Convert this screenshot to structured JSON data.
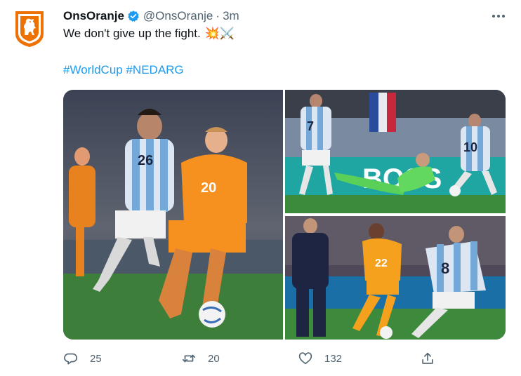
{
  "tweet": {
    "display_name": "OnsOranje",
    "handle": "@OnsOranje",
    "separator": "·",
    "time": "3m",
    "text": "We don't give up the fight.",
    "emojis": "💥⚔️",
    "hashtags": [
      "#WorldCup",
      "#NEDARG"
    ],
    "icons": {
      "avatar": "knvb-lion-logo",
      "verified": "verified-badge-icon",
      "more": "more-options-icon"
    }
  },
  "photos": [
    {
      "jersey_numbers": [
        "26",
        "20"
      ]
    },
    {
      "jersey_numbers": [
        "7",
        "10"
      ],
      "board_text": "BOSS"
    },
    {
      "jersey_numbers": [
        "22",
        "8"
      ]
    }
  ],
  "actions": {
    "replies": "25",
    "retweets": "20",
    "likes": "132",
    "icons": [
      "reply-icon",
      "retweet-icon",
      "like-icon",
      "share-icon"
    ]
  },
  "colors": {
    "accent": "#1d9bf0",
    "text": "#0f1419",
    "muted": "#536471",
    "orange": "#f26b1d"
  }
}
